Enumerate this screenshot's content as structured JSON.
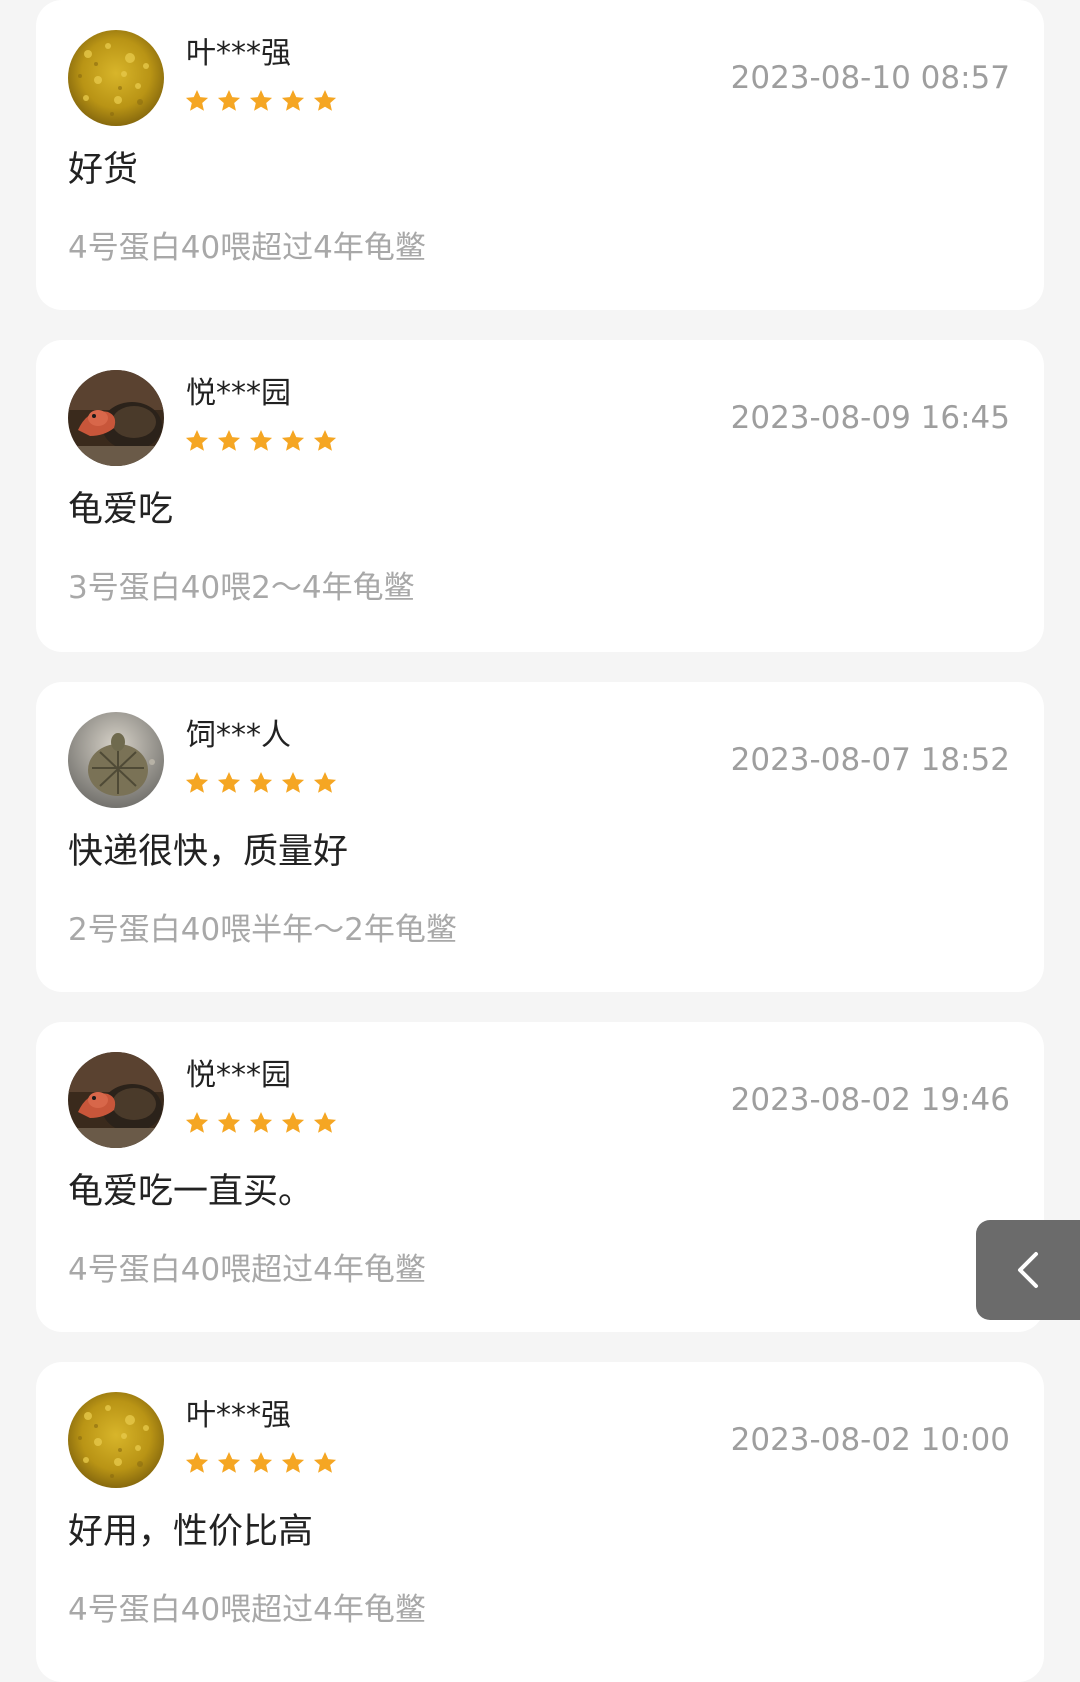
{
  "colors": {
    "star": "#f5a623",
    "timestamp": "#9e9e9e",
    "spec": "#a8a8a8",
    "card_bg": "#ffffff",
    "page_bg": "#f5f5f5",
    "back_button": "#6b6b6b"
  },
  "reviews": [
    {
      "username": "叶***强",
      "avatar": "yellow-flowers",
      "rating": 5,
      "timestamp": "2023-08-10 08:57",
      "comment": "好货",
      "spec": "4号蛋白40喂超过4年龟鳖"
    },
    {
      "username": "悦***园",
      "avatar": "turtle-red",
      "rating": 5,
      "timestamp": "2023-08-09 16:45",
      "comment": "龟爱吃",
      "spec": "3号蛋白40喂2～4年龟鳖"
    },
    {
      "username": "饲***人",
      "avatar": "turtle-shell",
      "rating": 5,
      "timestamp": "2023-08-07 18:52",
      "comment": "快递很快，质量好",
      "spec": "2号蛋白40喂半年～2年龟鳖"
    },
    {
      "username": "悦***园",
      "avatar": "turtle-red",
      "rating": 5,
      "timestamp": "2023-08-02 19:46",
      "comment": "龟爱吃一直买。",
      "spec": "4号蛋白40喂超过4年龟鳖"
    },
    {
      "username": "叶***强",
      "avatar": "yellow-flowers",
      "rating": 5,
      "timestamp": "2023-08-02 10:00",
      "comment": "好用，性价比高",
      "spec": "4号蛋白40喂超过4年龟鳖"
    }
  ],
  "back_button": {
    "icon": "chevron-left-icon"
  }
}
